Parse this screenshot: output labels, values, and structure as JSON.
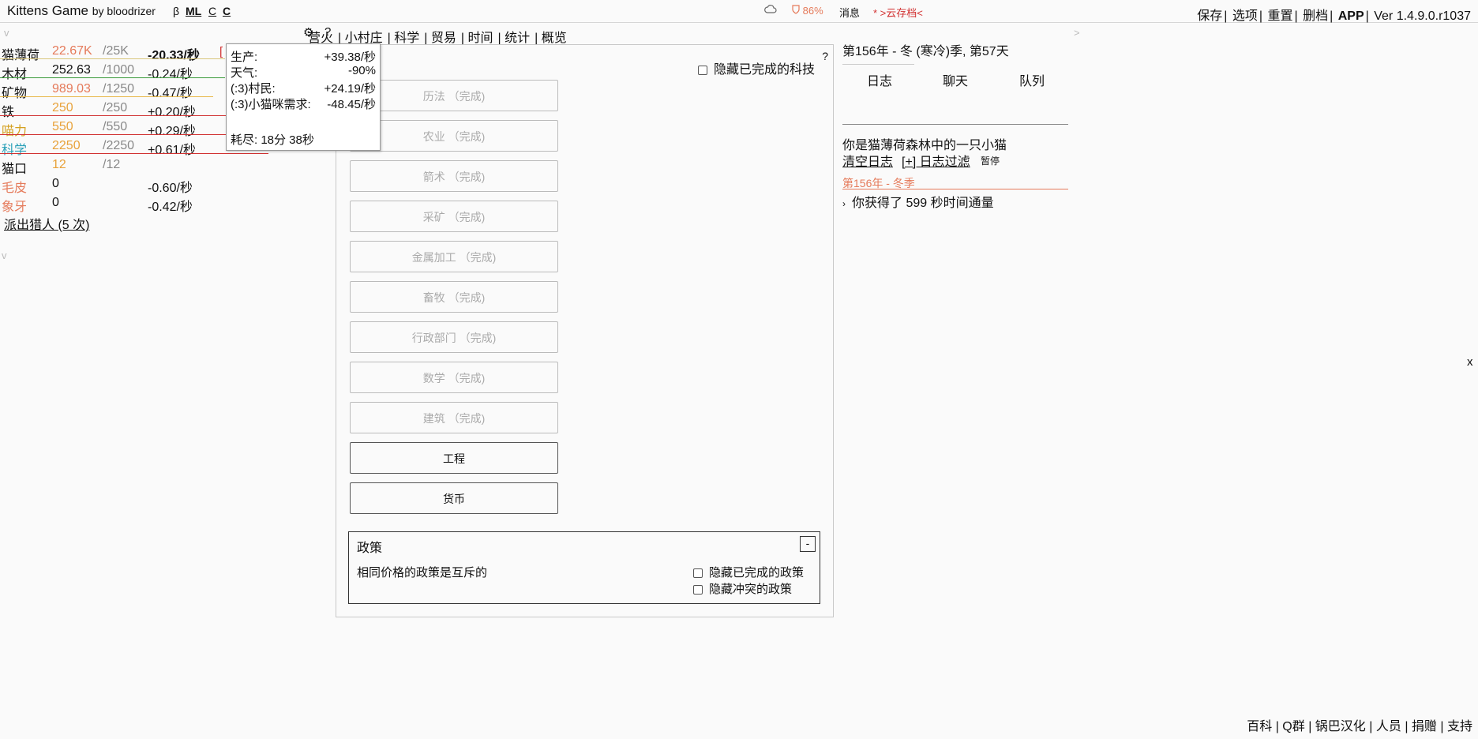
{
  "header": {
    "title": "Kittens Game",
    "by": "by bloodrizer",
    "beta": "β",
    "ml": "ML",
    "c1": "C",
    "c2": "C",
    "weather_icon": "cloud-icon",
    "energy": "86%",
    "messages": "消息",
    "cloud_save": "* >云存档<",
    "menu": [
      "保存",
      "选项",
      "重置",
      "删档",
      "APP",
      "Ver 1.4.9.0.r1037"
    ]
  },
  "resources": [
    {
      "name": "猫薄荷",
      "value": "22.67K",
      "max": "/25K",
      "rate": "-20.33/秒",
      "color": "#e57a5a",
      "name_color": "#111",
      "line_color": "#d9c67a",
      "line_width": 285
    },
    {
      "name": "木材",
      "value": "252.63",
      "max": "/1000",
      "rate": "-0.24/秒",
      "color": "#111",
      "name_color": "#111",
      "line_color": "#3a9a3a",
      "line_width": 285
    },
    {
      "name": "矿物",
      "value": "989.03",
      "max": "/1250",
      "rate": "-0.47/秒",
      "color": "#e57a5a",
      "name_color": "#111",
      "line_color": "#e8b84a",
      "line_width": 270
    },
    {
      "name": "铁",
      "value": "250",
      "max": "/250",
      "rate": "+0.20/秒",
      "color": "#e8a23a",
      "name_color": "#111",
      "line_color": "#d03030",
      "line_width": 287
    },
    {
      "name": "喵力",
      "value": "550",
      "max": "/550",
      "rate": "+0.29/秒",
      "color": "#e8a23a",
      "name_color": "#d4a020",
      "line_color": "#d03030",
      "line_width": 287
    },
    {
      "name": "科学",
      "value": "2250",
      "max": "/2250",
      "rate": "+0.61/秒",
      "color": "#e8a23a",
      "name_color": "#2aa0b8",
      "line_color": "#d03030",
      "line_width": 340
    },
    {
      "name": "猫口",
      "value": "12",
      "max": "/12",
      "rate": "",
      "color": "#e8a23a",
      "name_color": "#111",
      "line_color": "",
      "line_width": 0
    },
    {
      "name": "毛皮",
      "value": "0",
      "max": "",
      "rate": "-0.60/秒",
      "color": "#111",
      "name_color": "#e57a5a",
      "line_color": "",
      "line_width": 0
    },
    {
      "name": "象牙",
      "value": "0",
      "max": "",
      "rate": "-0.42/秒",
      "color": "#111",
      "name_color": "#e57a5a",
      "line_color": "",
      "line_width": 0
    }
  ],
  "hunt_link": "派出猎人 (5 次)",
  "tooltip": {
    "rows": [
      {
        "label": "生产:",
        "value": "+39.38/秒"
      },
      {
        "label": "天气:",
        "value": "-90%"
      },
      {
        "label": "(:3)村民:",
        "value": "+24.19/秒"
      },
      {
        "label": "(:3)小猫咪需求:",
        "value": "-48.45/秒"
      }
    ],
    "deplete": "耗尽: 18分 38秒"
  },
  "tabs": [
    "营火",
    "小村庄",
    "科学",
    "贸易",
    "时间",
    "统计",
    "概览"
  ],
  "science": {
    "help": "?",
    "hide_completed": "隐藏已完成的科技",
    "techs": [
      {
        "label": "历法 （完成)",
        "done": true
      },
      {
        "label": "农业 （完成)",
        "done": true
      },
      {
        "label": "箭术 （完成)",
        "done": true
      },
      {
        "label": "采矿 （完成)",
        "done": true
      },
      {
        "label": "金属加工 （完成)",
        "done": true
      },
      {
        "label": "畜牧 （完成)",
        "done": true
      },
      {
        "label": "行政部门 （完成)",
        "done": true
      },
      {
        "label": "数学 （完成)",
        "done": true
      },
      {
        "label": "建筑 （完成)",
        "done": true
      },
      {
        "label": "工程",
        "done": false
      },
      {
        "label": "货币",
        "done": false
      }
    ]
  },
  "policy": {
    "title": "政策",
    "collapse": "-",
    "desc": "相同价格的政策是互斥的",
    "hide_completed": "隐藏已完成的政策",
    "hide_conflict": "隐藏冲突的政策"
  },
  "log": {
    "date": "第156年 - 冬 (寒冷)季, 第57天",
    "tabs": [
      "日志",
      "聊天",
      "队列"
    ],
    "intro": "你是猫薄荷森林中的一只小猫",
    "clear": "清空日志",
    "filter": "[+] 日志过滤",
    "pause": "暂停",
    "season_header": "第156年 - 冬季",
    "entry": "你获得了 599 秒时间通量"
  },
  "misc": {
    "close_x": "x",
    "collapse_v1": "v",
    "collapse_v2": "v",
    "right_arrow": ">",
    "gear": "⚙",
    "question": "?"
  },
  "footer": [
    "百科",
    "Q群",
    "锅巴汉化",
    "人员",
    "捐赠",
    "支持"
  ]
}
